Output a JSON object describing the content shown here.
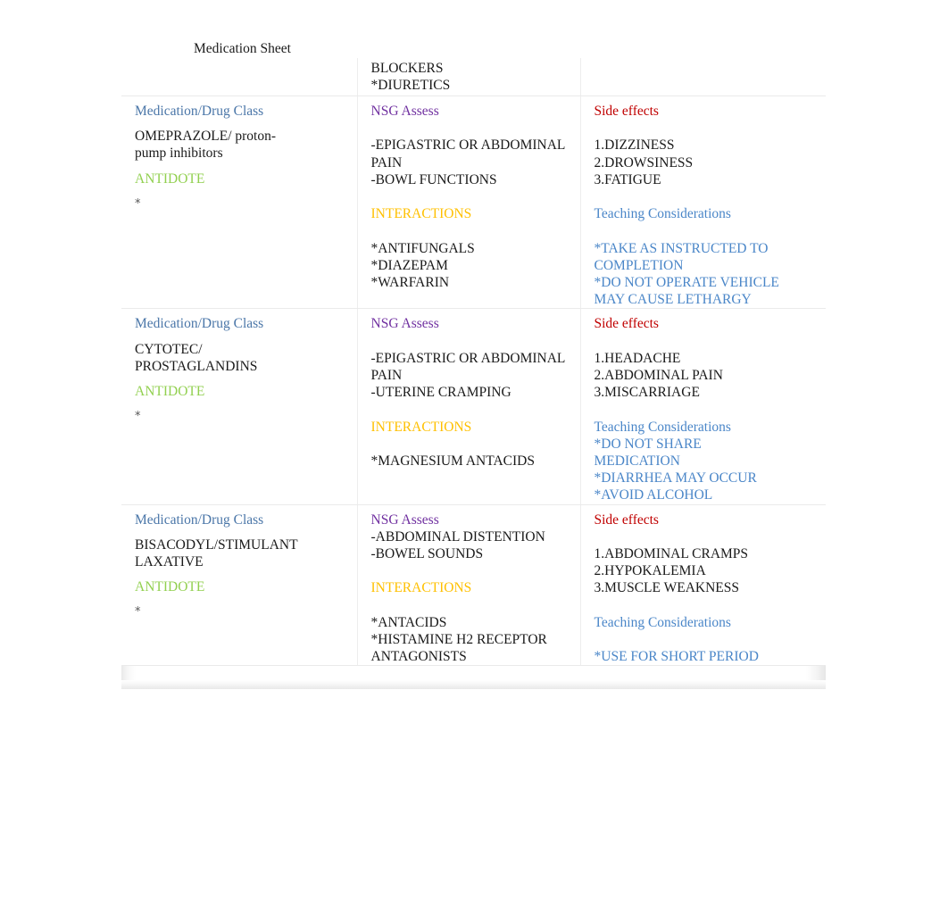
{
  "document": {
    "title": "Medication Sheet"
  },
  "table": {
    "top_fragment": {
      "col1": [],
      "col2": [
        "BLOCKERS",
        "*DIURETICS"
      ],
      "col3": []
    },
    "labels": {
      "medication_drug_class": "Medication/Drug Class",
      "nsg_assess": "NSG Assess",
      "side_effects": "Side effects",
      "antidote": "ANTIDOTE",
      "interactions": "INTERACTIONS",
      "teaching_considerations": "Teaching Considerations",
      "antidote_value": "*"
    },
    "colors": {
      "medication_drug_class": "#4a76a8",
      "nsg_assess": "#7030a0",
      "side_effects": "#c00000",
      "antidote": "#92d050",
      "interactions": "#ffc000",
      "teaching_considerations": "#4a86c8",
      "body_text": "#1a1a1a"
    },
    "rows": [
      {
        "drug_name": "OMEPRAZOLE/ proton-\npump inhibitors",
        "antidote": "*",
        "assessments": "-EPIGASTRIC OR ABDOMINAL\nPAIN\n-BOWL FUNCTIONS",
        "interactions": "*ANTIFUNGALS\n*DIAZEPAM\n*WARFARIN",
        "side_effects": "1.DIZZINESS\n2.DROWSINESS\n3.FATIGUE",
        "teaching": "*TAKE AS INSTRUCTED TO\nCOMPLETION\n*DO NOT OPERATE VEHICLE\nMAY CAUSE LETHARGY"
      },
      {
        "drug_name": "CYTOTEC/\nPROSTAGLANDINS",
        "antidote": "*",
        "assessments": "-EPIGASTRIC OR ABDOMINAL\nPAIN\n-UTERINE CRAMPING",
        "interactions": "*MAGNESIUM ANTACIDS",
        "side_effects": "1.HEADACHE\n2.ABDOMINAL PAIN\n3.MISCARRIAGE",
        "teaching": "*DO NOT SHARE\nMEDICATION\n*DIARRHEA MAY OCCUR\n*AVOID ALCOHOL"
      },
      {
        "drug_name": "BISACODYL/STIMULANT\nLAXATIVE",
        "antidote": "*",
        "assessments": "-ABDOMINAL DISTENTION\n-BOWEL SOUNDS",
        "interactions": "*ANTACIDS\n*HISTAMINE H2 RECEPTOR\nANTAGONISTS",
        "side_effects": "1.ABDOMINAL CRAMPS\n2.HYPOKALEMIA\n3.MUSCLE WEAKNESS",
        "teaching": "*USE FOR SHORT PERIOD"
      }
    ]
  }
}
